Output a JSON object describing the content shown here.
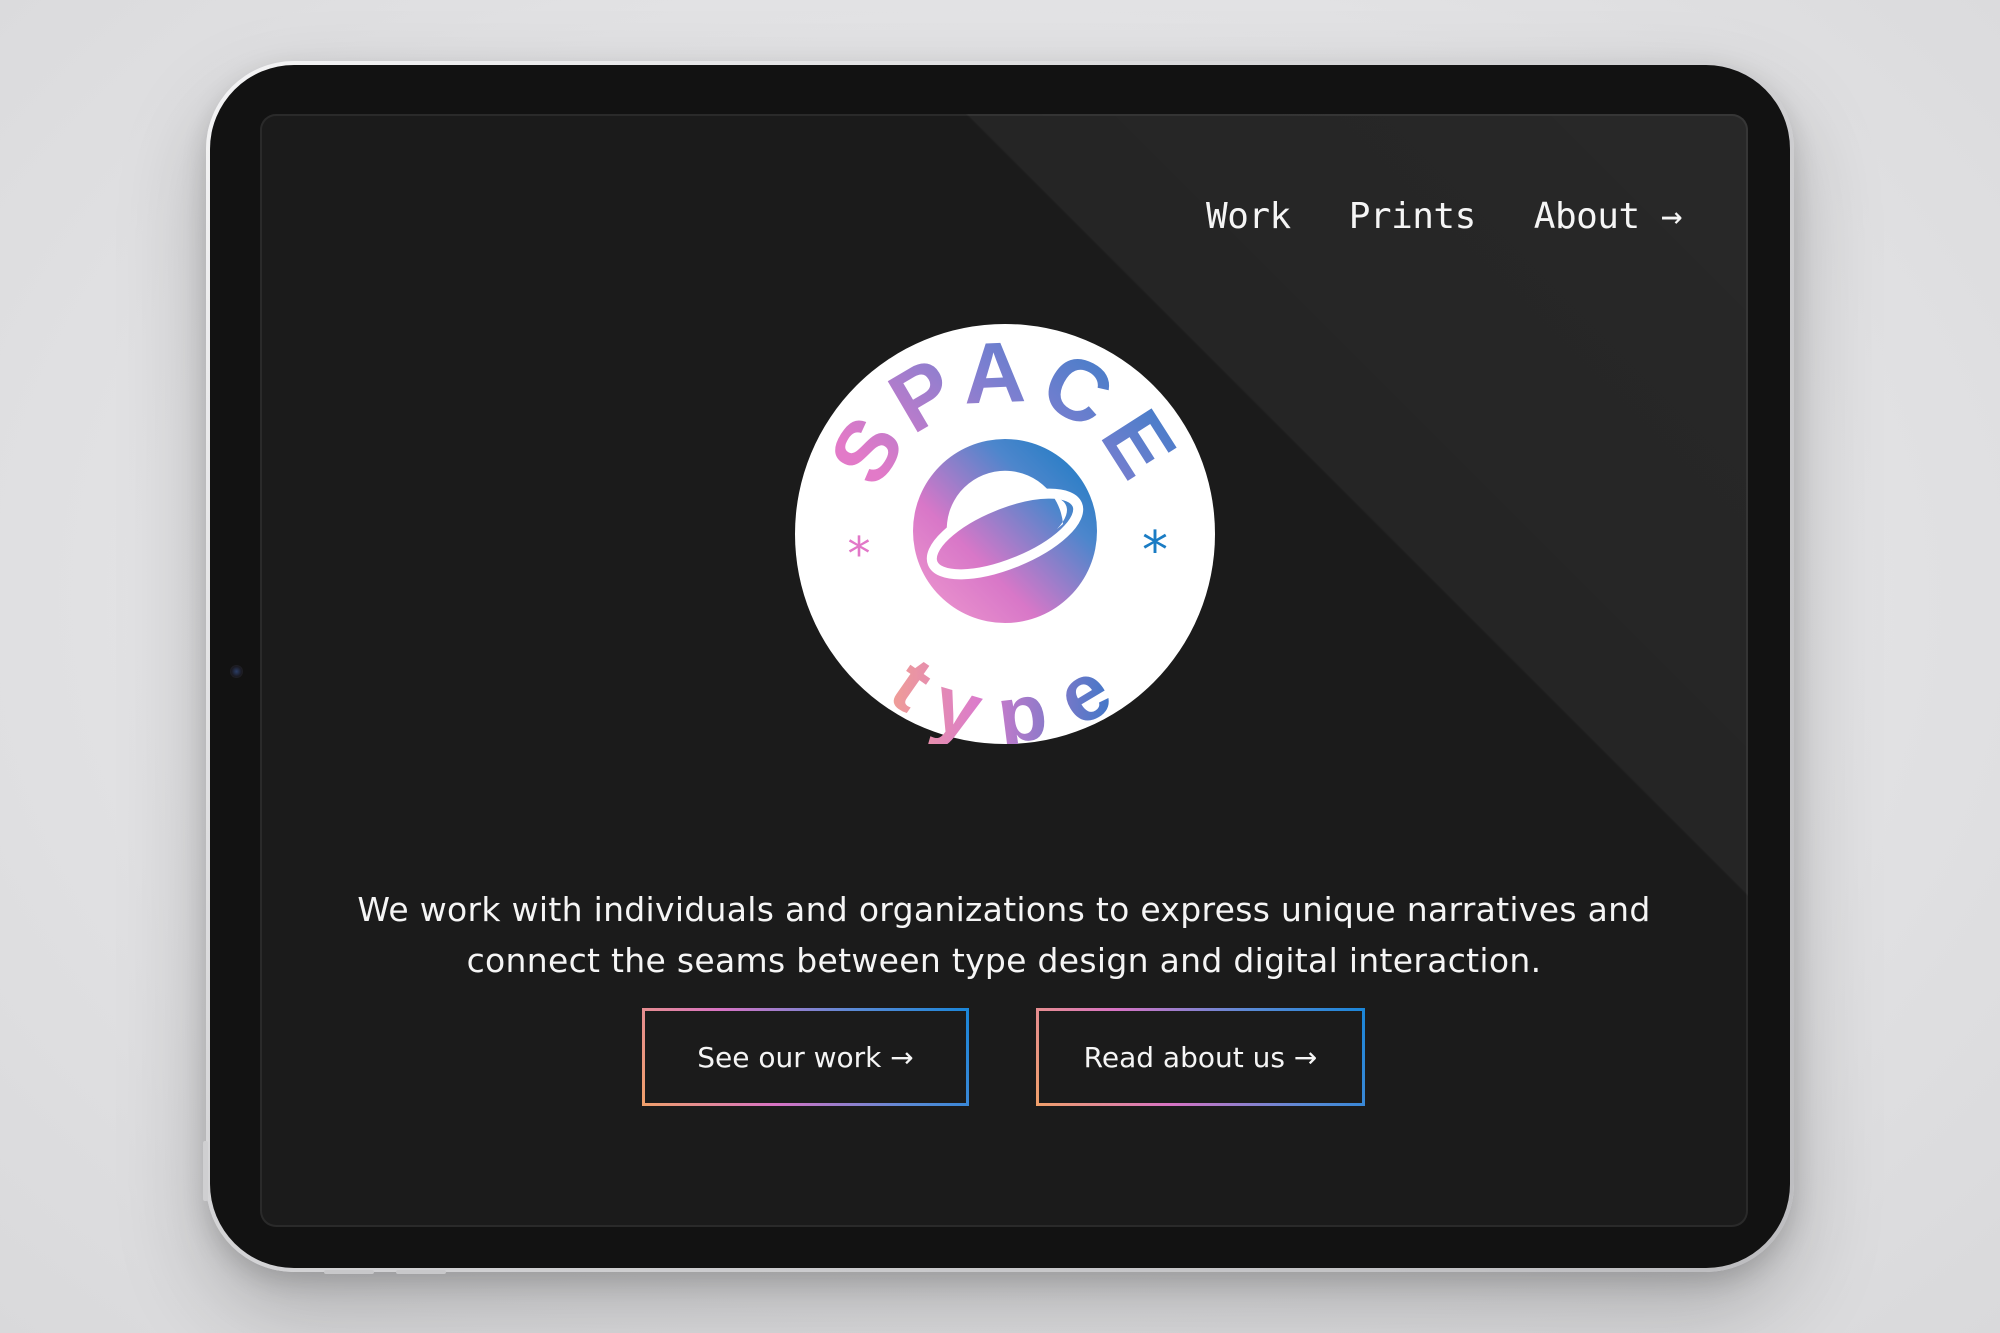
{
  "nav": {
    "items": [
      {
        "label": "Work"
      },
      {
        "label": "Prints"
      },
      {
        "label": "About →"
      }
    ]
  },
  "logo": {
    "top_text": "SPACE",
    "bottom_text": "type",
    "colors": {
      "pink": "#e277c8",
      "blue": "#1a7cc4",
      "peach": "#f2a18a"
    }
  },
  "hero": {
    "tagline_line1": "We work with individuals and organizations to express unique narratives and",
    "tagline_line2": "connect the seams between type design and digital interaction."
  },
  "cta": {
    "see_work": "See our work →",
    "read_about": "Read about us →"
  },
  "colors": {
    "background": "#1b1b1b",
    "text": "#f5f5f5",
    "gradient_start": "#f0a06a",
    "gradient_mid": "#d873c4",
    "gradient_end": "#1a86d8"
  }
}
